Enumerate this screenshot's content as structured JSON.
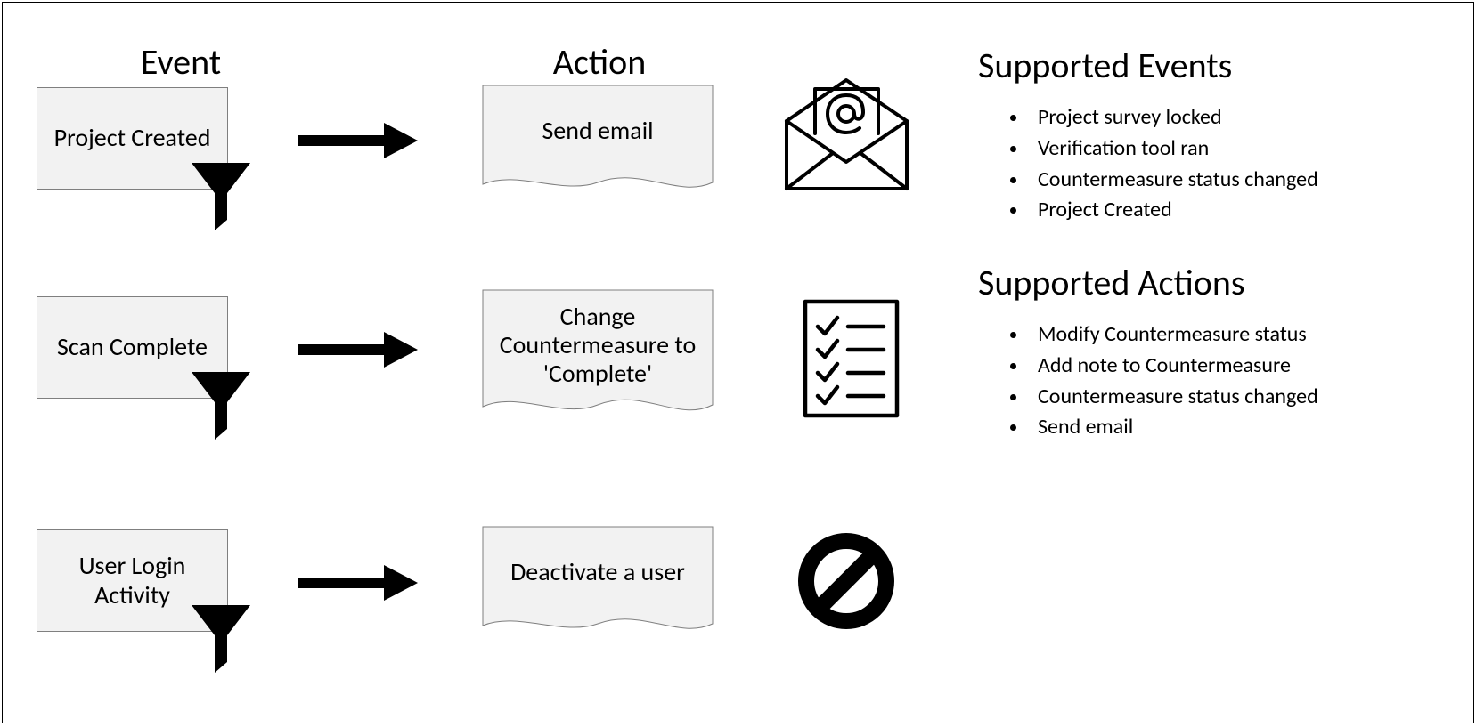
{
  "headings": {
    "event": "Event",
    "action": "Action",
    "supported_events": "Supported Events",
    "supported_actions": "Supported Actions"
  },
  "rows": [
    {
      "event": "Project Created",
      "action": "Send email",
      "icon": "email-at-icon"
    },
    {
      "event": "Scan Complete",
      "action": "Change Countermeasure to 'Complete'",
      "icon": "checklist-icon"
    },
    {
      "event": "User Login Activity",
      "action": "Deactivate a user",
      "icon": "prohibit-icon"
    }
  ],
  "supported_events": [
    "Project survey locked",
    "Verification tool ran",
    "Countermeasure status changed",
    "Project Created"
  ],
  "supported_actions": [
    "Modify Countermeasure status",
    "Add note to Countermeasure",
    "Countermeasure status changed",
    "Send email"
  ]
}
